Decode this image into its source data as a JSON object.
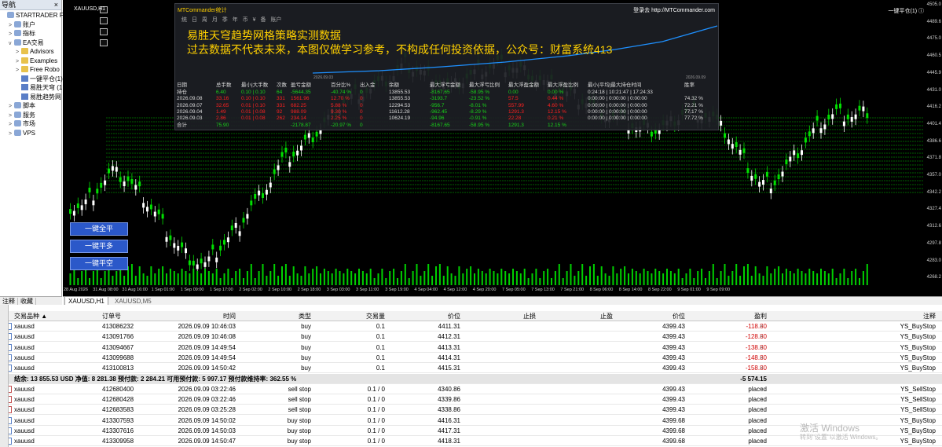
{
  "navigator": {
    "title": "导航",
    "close": "×",
    "items": [
      {
        "label": "STARTRADER Fina",
        "ind": 0,
        "icon": "account-logo",
        "tw": ""
      },
      {
        "label": "账户",
        "ind": 1,
        "icon": "accounts-icon",
        "tw": ">"
      },
      {
        "label": "指标",
        "ind": 1,
        "icon": "indicators-icon",
        "tw": ">"
      },
      {
        "label": "EA交易",
        "ind": 1,
        "icon": "experts-icon",
        "tw": "v"
      },
      {
        "label": "Advisors",
        "ind": 2,
        "icon": "folder-icon",
        "tw": ">"
      },
      {
        "label": "Examples",
        "ind": 2,
        "icon": "folder-icon",
        "tw": ">"
      },
      {
        "label": "Free Robo",
        "ind": 2,
        "icon": "folder-icon",
        "tw": ">"
      },
      {
        "label": "一键平仓(1)",
        "ind": 2,
        "icon": "expert-file-icon",
        "tw": ""
      },
      {
        "label": "易胜天穹 (1",
        "ind": 2,
        "icon": "expert-file-icon",
        "tw": ""
      },
      {
        "label": "易胜趋势网",
        "ind": 2,
        "icon": "expert-file-icon",
        "tw": ""
      },
      {
        "label": "脚本",
        "ind": 1,
        "icon": "scripts-icon",
        "tw": ">"
      },
      {
        "label": "服务",
        "ind": 1,
        "icon": "services-icon",
        "tw": ">"
      },
      {
        "label": "市场",
        "ind": 1,
        "icon": "market-icon",
        "tw": ">"
      },
      {
        "label": "VPS",
        "ind": 1,
        "icon": "vps-icon",
        "tw": ">"
      }
    ],
    "tabs": [
      "注释",
      "收藏"
    ]
  },
  "chart": {
    "symbol": "XAUUSD,H1",
    "top_right": "一键平仓(1) ⓘ",
    "buttons": [
      "一键全平",
      "一键平多",
      "一键平空"
    ],
    "y_ticks": [
      "4505.0",
      "4489.6",
      "4475.0",
      "4460.5",
      "4445.9",
      "4431.0",
      "4416.2",
      "4401.4",
      "4386.6",
      "4371.8",
      "4357.0",
      "4342.2",
      "4327.4",
      "4312.6",
      "4297.8",
      "4283.0",
      "4268.2"
    ],
    "x_ticks": [
      "28 Aug 2026",
      "31 Aug 08:00",
      "31 Aug 16:00",
      "1 Sep 01:00",
      "1 Sep 09:00",
      "1 Sep 17:00",
      "2 Sep 02:00",
      "2 Sep 10:00",
      "2 Sep 18:00",
      "3 Sep 03:00",
      "3 Sep 11:00",
      "3 Sep 19:00",
      "4 Sep 04:00",
      "4 Sep 12:00",
      "4 Sep 20:00",
      "7 Sep 05:00",
      "7 Sep 13:00",
      "7 Sep 21:00",
      "8 Sep 06:00",
      "8 Sep 14:00",
      "8 Sep 22:00",
      "9 Sep 01:00",
      "9 Sep 09:00"
    ],
    "colors": {
      "bull": "#ffffff",
      "bear": "#00e000",
      "grid": "#00c000"
    },
    "candles_seed": [
      4330,
      4345,
      4360,
      4352,
      4338,
      4320,
      4300,
      4286,
      4280,
      4295,
      4310,
      4330,
      4348,
      4368,
      4378,
      4390,
      4405,
      4420,
      4428,
      4432,
      4440,
      4452,
      4446,
      4438,
      4432,
      4440,
      4448,
      4452,
      4450,
      4445,
      4436,
      4430,
      4425,
      4418,
      4410,
      4405,
      4398,
      4395,
      4400,
      4410,
      4412,
      4405,
      4390,
      4370,
      4350,
      4352,
      4368,
      4385,
      4402,
      4410,
      4408,
      4412
    ],
    "volume_levels": [
      0.5,
      0.7,
      0.3,
      0.6,
      0.9,
      0.4,
      0.8,
      0.5,
      0.7,
      0.6
    ]
  },
  "panel": {
    "title": "MTCommander统计",
    "url": "登录去 http://MTCommander.com",
    "menu": "统 日 周 月 季 年 币 ¥ 备 账户",
    "headline1": "易胜天穹趋势网格策略实测数据",
    "headline2": "过去数据不代表未来，本图仅做学习参考，不构成任何投资依据，公众号：财富系统413",
    "date_start": "2026.09.03",
    "date_end": "2026.09.09",
    "headers": [
      "日期",
      "总手数",
      "最小|大手数",
      "次数",
      "盈亏金额",
      "百分比%",
      "出入金",
      "余额",
      "最大浮亏金额",
      "最大浮亏比例",
      "最大浮盈金额",
      "最大浮盈比例",
      "最小|平均|最大持仓时间",
      "胜率"
    ],
    "rows": [
      {
        "color": "#19d219",
        "cells": [
          "持仓",
          "6.40",
          "0.10 | 0.10",
          "64",
          "-5644.35",
          "-40.74 %",
          "0",
          "13855.53",
          "-8167.65",
          "-58.95 %",
          "0.00",
          "0.00 %",
          "0:24:18 | 10:21:47 | 17:24:33",
          ""
        ]
      },
      {
        "color": "#ff2020",
        "cells": [
          "2026.09.08",
          "33.16",
          "0.10 | 0.10",
          "331",
          "1561.96",
          "12.70 %",
          "0",
          "13855.53",
          "-3193.7",
          "-23.52 %",
          "57.5",
          "0.44 %",
          "0:00:00 | 0:00:00 | 0:00:00",
          "74.32 %"
        ]
      },
      {
        "color": "#ff2020",
        "cells": [
          "2026.09.07",
          "32.65",
          "0.01 | 0.10",
          "331",
          "682.25",
          "5.88 %",
          "0",
          "12294.53",
          "-956.7",
          "-8.01 %",
          "557.99",
          "4.60 %",
          "0:00:00 | 0:00:00 | 0:00:00",
          "72.21 %"
        ]
      },
      {
        "color": "#ff2020",
        "cells": [
          "2026.09.04",
          "1.49",
          "0.01 | 0.08",
          "92",
          "988.09",
          "9.30 %",
          "0",
          "11612.28",
          "-962.45",
          "-8.29 %",
          "1291.3",
          "12.15 %",
          "0:00:00 | 0:00:00 | 0:00:00",
          "77.17 %"
        ]
      },
      {
        "color": "#ff2020",
        "cells": [
          "2026.09.03",
          "2.86",
          "0.01 | 0.08",
          "262",
          "234.14",
          "2.25 %",
          "0",
          "10624.19",
          "-94.96",
          "-0.91 %",
          "22.28",
          "0.21 %",
          "0:00:00 | 0:00:00 | 0:00:00",
          "77.72 %"
        ]
      },
      {
        "color": "#19d219",
        "cells": [
          "合计",
          "75.90",
          "",
          "",
          "-2178.87",
          "-20.97 %",
          "0",
          "",
          "-8167.65",
          "-58.95 %",
          "1291.3",
          "12.15 %",
          "",
          ""
        ]
      }
    ]
  },
  "tabstrip": [
    "XAUUSD,H1",
    "XAUUSD,M5"
  ],
  "terminal": {
    "headers": [
      "交易品种 ▲",
      "订单号",
      "时间",
      "类型",
      "交易量",
      "价位",
      "止损",
      "止盈",
      "价位",
      "盈利",
      "注释"
    ],
    "rows": [
      {
        "kind": "b",
        "cells": [
          "xauusd",
          "413086232",
          "2026.09.09 10:46:03",
          "buy",
          "0.1",
          "4411.31",
          "",
          "",
          "4399.43",
          "-118.80",
          "YS_BuyStop"
        ]
      },
      {
        "kind": "b",
        "cells": [
          "xauusd",
          "413091766",
          "2026.09.09 10:46:08",
          "buy",
          "0.1",
          "4412.31",
          "",
          "",
          "4399.43",
          "-128.80",
          "YS_BuyStop"
        ]
      },
      {
        "kind": "b",
        "cells": [
          "xauusd",
          "413094667",
          "2026.09.09 14:49:54",
          "buy",
          "0.1",
          "4413.31",
          "",
          "",
          "4399.43",
          "-138.80",
          "YS_BuyStop"
        ]
      },
      {
        "kind": "b",
        "cells": [
          "xauusd",
          "413099688",
          "2026.09.09 14:49:54",
          "buy",
          "0.1",
          "4414.31",
          "",
          "",
          "4399.43",
          "-148.80",
          "YS_BuyStop"
        ]
      },
      {
        "kind": "b",
        "cells": [
          "xauusd",
          "413100813",
          "2026.09.09 14:50:42",
          "buy",
          "0.1",
          "4415.31",
          "",
          "",
          "4399.43",
          "-158.80",
          "YS_BuyStop"
        ]
      },
      {
        "kind": "s",
        "text": "结余: 13 855.53 USD  净值: 8 281.38  预付款: 2 284.21  可用预付款: 5 997.17  预付款维持率: 362.55 %",
        "profit": "-5 574.15"
      },
      {
        "kind": "ss",
        "cells": [
          "xauusd",
          "412680400",
          "2026.09.09 03:22:46",
          "sell stop",
          "0.1 / 0",
          "4340.86",
          "",
          "",
          "4399.43",
          "placed",
          "YS_SellStop"
        ]
      },
      {
        "kind": "ss",
        "cells": [
          "xauusd",
          "412680428",
          "2026.09.09 03:22:46",
          "sell stop",
          "0.1 / 0",
          "4339.86",
          "",
          "",
          "4399.43",
          "placed",
          "YS_SellStop"
        ]
      },
      {
        "kind": "ss",
        "cells": [
          "xauusd",
          "412683583",
          "2026.09.09 03:25:28",
          "sell stop",
          "0.1 / 0",
          "4338.86",
          "",
          "",
          "4399.43",
          "placed",
          "YS_SellStop"
        ]
      },
      {
        "kind": "bs",
        "cells": [
          "xauusd",
          "413307593",
          "2026.09.09 14:50:02",
          "buy stop",
          "0.1 / 0",
          "4416.31",
          "",
          "",
          "4399.68",
          "placed",
          "YS_BuyStop"
        ]
      },
      {
        "kind": "bs",
        "cells": [
          "xauusd",
          "413307616",
          "2026.09.09 14:50:03",
          "buy stop",
          "0.1 / 0",
          "4417.31",
          "",
          "",
          "4399.68",
          "placed",
          "YS_BuyStop"
        ]
      },
      {
        "kind": "bs",
        "cells": [
          "xauusd",
          "413309958",
          "2026.09.09 14:50:47",
          "buy stop",
          "0.1 / 0",
          "4418.31",
          "",
          "",
          "4399.68",
          "placed",
          "YS_BuyStop"
        ]
      }
    ],
    "watermark1": "激活 Windows",
    "watermark2": "转到\"设置\"以激活 Windows。"
  }
}
